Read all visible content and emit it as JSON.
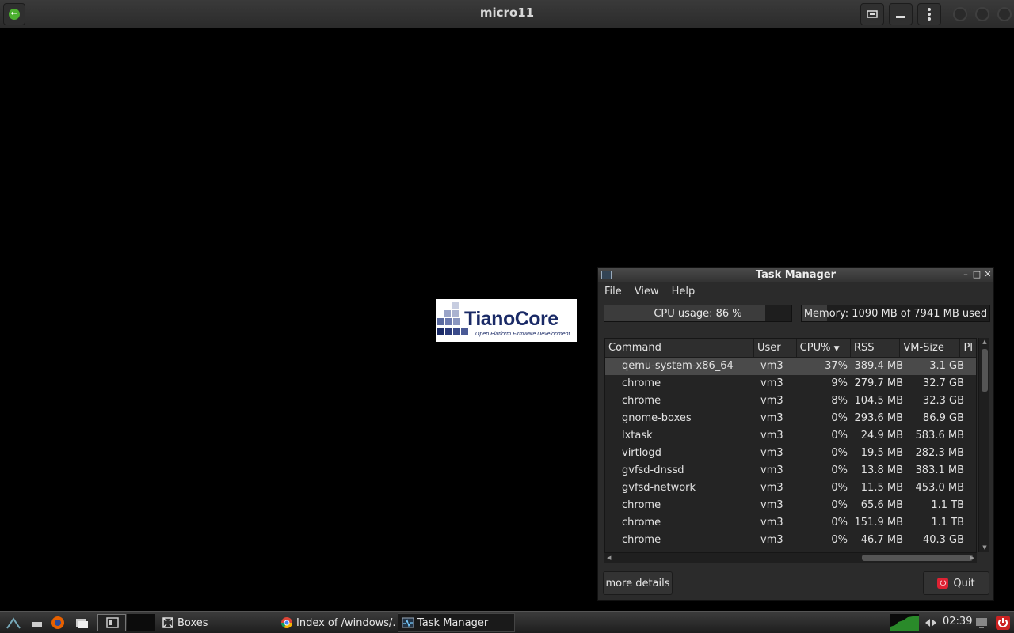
{
  "boxes": {
    "title": "micro11"
  },
  "vm": {
    "logo_text": "TianoCore",
    "logo_subtitle": "Open Platform Firmware Development"
  },
  "task_manager": {
    "title": "Task Manager",
    "menu": [
      "File",
      "View",
      "Help"
    ],
    "cpu_label": "CPU usage: 86 %",
    "cpu_fraction": 0.86,
    "memory_label": "Memory: 1090 MB of 7941 MB used",
    "memory_fraction": 0.137,
    "columns": [
      "Command",
      "User",
      "CPU%",
      "RSS",
      "VM-Size",
      "PI"
    ],
    "rows": [
      {
        "command": "qemu-system-x86_64",
        "user": "vm3",
        "cpu": "37%",
        "rss": "389.4 MB",
        "vm": "3.1 GB"
      },
      {
        "command": "chrome",
        "user": "vm3",
        "cpu": "9%",
        "rss": "279.7 MB",
        "vm": "32.7 GB"
      },
      {
        "command": "chrome",
        "user": "vm3",
        "cpu": "8%",
        "rss": "104.5 MB",
        "vm": "32.3 GB"
      },
      {
        "command": "gnome-boxes",
        "user": "vm3",
        "cpu": "0%",
        "rss": "293.6 MB",
        "vm": "86.9 GB"
      },
      {
        "command": "lxtask",
        "user": "vm3",
        "cpu": "0%",
        "rss": "24.9 MB",
        "vm": "583.6 MB"
      },
      {
        "command": "virtlogd",
        "user": "vm3",
        "cpu": "0%",
        "rss": "19.5 MB",
        "vm": "282.3 MB"
      },
      {
        "command": "gvfsd-dnssd",
        "user": "vm3",
        "cpu": "0%",
        "rss": "13.8 MB",
        "vm": "383.1 MB"
      },
      {
        "command": "gvfsd-network",
        "user": "vm3",
        "cpu": "0%",
        "rss": "11.5 MB",
        "vm": "453.0 MB"
      },
      {
        "command": "chrome",
        "user": "vm3",
        "cpu": "0%",
        "rss": "65.6 MB",
        "vm": "1.1 TB"
      },
      {
        "command": "chrome",
        "user": "vm3",
        "cpu": "0%",
        "rss": "151.9 MB",
        "vm": "1.1 TB"
      },
      {
        "command": "chrome",
        "user": "vm3",
        "cpu": "0%",
        "rss": "46.7 MB",
        "vm": "40.3 GB"
      }
    ],
    "more_details_label": "more details",
    "quit_label": "Quit"
  },
  "panel": {
    "tasks": [
      "Boxes",
      "Index of /windows/...",
      "Task Manager"
    ],
    "clock": "02:39"
  }
}
